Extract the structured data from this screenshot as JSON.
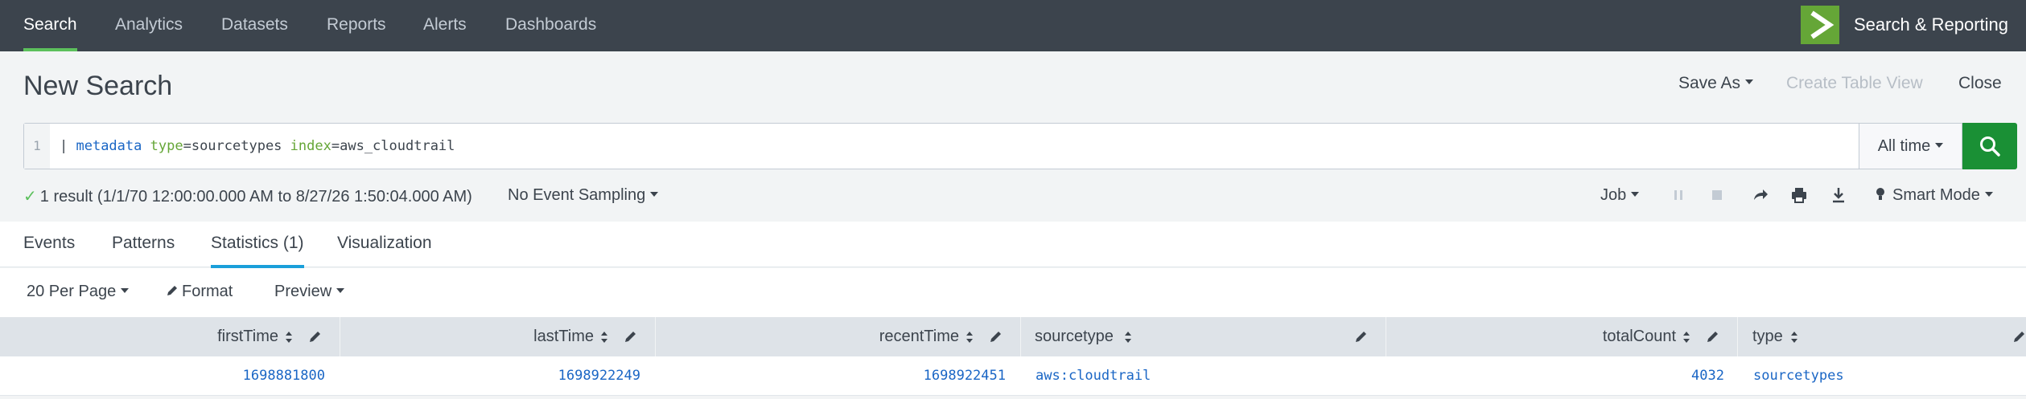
{
  "nav": {
    "items": [
      {
        "label": "Search",
        "active": true
      },
      {
        "label": "Analytics",
        "active": false
      },
      {
        "label": "Datasets",
        "active": false
      },
      {
        "label": "Reports",
        "active": false
      },
      {
        "label": "Alerts",
        "active": false
      },
      {
        "label": "Dashboards",
        "active": false
      }
    ],
    "app_name": "Search & Reporting",
    "logo_icon": "splunk-chevron-icon"
  },
  "header": {
    "title": "New Search",
    "save_as": "Save As",
    "create_table_view": "Create Table View",
    "close": "Close"
  },
  "search": {
    "line_number": "1",
    "query": {
      "pipe": "| ",
      "command": "metadata",
      "arg1_key": "type",
      "arg1_val": "sourcetypes",
      "arg2_key": "index",
      "arg2_val": "aws_cloudtrail"
    },
    "time_range": "All time",
    "search_icon": "magnifier-icon"
  },
  "status": {
    "result_text": "1 result (1/1/70 12:00:00.000 AM to 8/27/26 1:50:04.000 AM)",
    "sampling": "No Event Sampling",
    "job": "Job",
    "mode": "Smart Mode"
  },
  "tabs": [
    {
      "label": "Events",
      "active": false
    },
    {
      "label": "Patterns",
      "active": false
    },
    {
      "label": "Statistics (1)",
      "active": true
    },
    {
      "label": "Visualization",
      "active": false
    }
  ],
  "results_toolbar": {
    "per_page": "20 Per Page",
    "format": "Format",
    "preview": "Preview"
  },
  "table": {
    "columns": [
      "firstTime",
      "lastTime",
      "recentTime",
      "sourcetype",
      "totalCount",
      "type"
    ],
    "rows": [
      [
        "1698881800",
        "1698922249",
        "1698922451",
        "aws:cloudtrail",
        "4032",
        "sourcetypes"
      ]
    ]
  },
  "colors": {
    "nav_bg": "#3c444d",
    "accent_green": "#5cc05c",
    "search_button": "#1a9035",
    "active_tab": "#1a9fda",
    "link_blue": "#1a66c5"
  }
}
